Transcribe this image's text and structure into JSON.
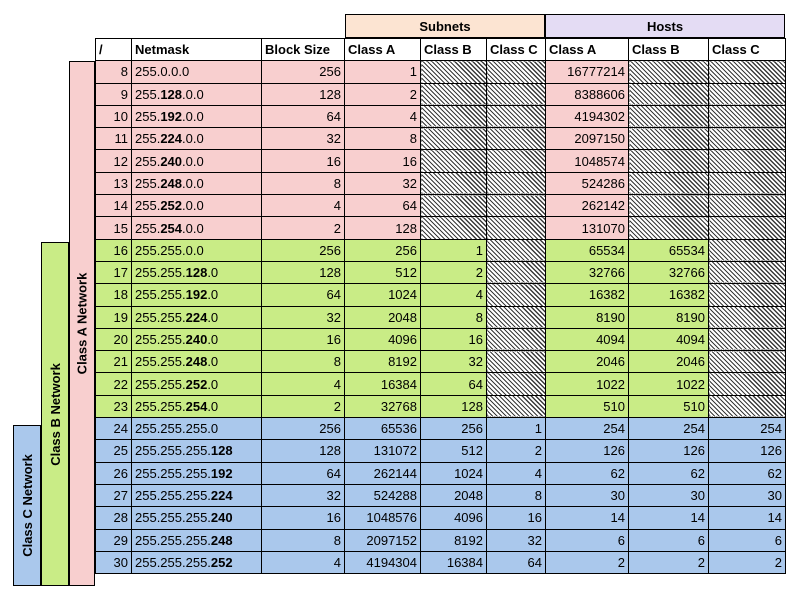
{
  "groups": {
    "subnets": "Subnets",
    "hosts": "Hosts"
  },
  "networks": {
    "a": "Class A Network",
    "b": "Class B Network",
    "c": "Class C Network"
  },
  "columns": [
    "/",
    "Netmask",
    "Block Size",
    "Class A",
    "Class B",
    "Class C",
    "Class A",
    "Class B",
    "Class C"
  ],
  "rows": [
    {
      "cls": "a",
      "prefix": "8",
      "nm_pre": "255.",
      "nm_bold": "",
      "nm_post": "0.0.0",
      "block": "256",
      "sa": "1",
      "sb": null,
      "sc": null,
      "ha": "16777214",
      "hb": null,
      "hc": null
    },
    {
      "cls": "a",
      "prefix": "9",
      "nm_pre": "255.",
      "nm_bold": "128",
      "nm_post": ".0.0",
      "block": "128",
      "sa": "2",
      "sb": null,
      "sc": null,
      "ha": "8388606",
      "hb": null,
      "hc": null
    },
    {
      "cls": "a",
      "prefix": "10",
      "nm_pre": "255.",
      "nm_bold": "192",
      "nm_post": ".0.0",
      "block": "64",
      "sa": "4",
      "sb": null,
      "sc": null,
      "ha": "4194302",
      "hb": null,
      "hc": null
    },
    {
      "cls": "a",
      "prefix": "11",
      "nm_pre": "255.",
      "nm_bold": "224",
      "nm_post": ".0.0",
      "block": "32",
      "sa": "8",
      "sb": null,
      "sc": null,
      "ha": "2097150",
      "hb": null,
      "hc": null
    },
    {
      "cls": "a",
      "prefix": "12",
      "nm_pre": "255.",
      "nm_bold": "240",
      "nm_post": ".0.0",
      "block": "16",
      "sa": "16",
      "sb": null,
      "sc": null,
      "ha": "1048574",
      "hb": null,
      "hc": null
    },
    {
      "cls": "a",
      "prefix": "13",
      "nm_pre": "255.",
      "nm_bold": "248",
      "nm_post": ".0.0",
      "block": "8",
      "sa": "32",
      "sb": null,
      "sc": null,
      "ha": "524286",
      "hb": null,
      "hc": null
    },
    {
      "cls": "a",
      "prefix": "14",
      "nm_pre": "255.",
      "nm_bold": "252",
      "nm_post": ".0.0",
      "block": "4",
      "sa": "64",
      "sb": null,
      "sc": null,
      "ha": "262142",
      "hb": null,
      "hc": null
    },
    {
      "cls": "a",
      "prefix": "15",
      "nm_pre": "255.",
      "nm_bold": "254",
      "nm_post": ".0.0",
      "block": "2",
      "sa": "128",
      "sb": null,
      "sc": null,
      "ha": "131070",
      "hb": null,
      "hc": null
    },
    {
      "cls": "b",
      "prefix": "16",
      "nm_pre": "255.255.",
      "nm_bold": "",
      "nm_post": "0.0",
      "block": "256",
      "sa": "256",
      "sb": "1",
      "sc": null,
      "ha": "65534",
      "hb": "65534",
      "hc": null
    },
    {
      "cls": "b",
      "prefix": "17",
      "nm_pre": "255.255.",
      "nm_bold": "128",
      "nm_post": ".0",
      "block": "128",
      "sa": "512",
      "sb": "2",
      "sc": null,
      "ha": "32766",
      "hb": "32766",
      "hc": null
    },
    {
      "cls": "b",
      "prefix": "18",
      "nm_pre": "255.255.",
      "nm_bold": "192",
      "nm_post": ".0",
      "block": "64",
      "sa": "1024",
      "sb": "4",
      "sc": null,
      "ha": "16382",
      "hb": "16382",
      "hc": null
    },
    {
      "cls": "b",
      "prefix": "19",
      "nm_pre": "255.255.",
      "nm_bold": "224",
      "nm_post": ".0",
      "block": "32",
      "sa": "2048",
      "sb": "8",
      "sc": null,
      "ha": "8190",
      "hb": "8190",
      "hc": null
    },
    {
      "cls": "b",
      "prefix": "20",
      "nm_pre": "255.255.",
      "nm_bold": "240",
      "nm_post": ".0",
      "block": "16",
      "sa": "4096",
      "sb": "16",
      "sc": null,
      "ha": "4094",
      "hb": "4094",
      "hc": null
    },
    {
      "cls": "b",
      "prefix": "21",
      "nm_pre": "255.255.",
      "nm_bold": "248",
      "nm_post": ".0",
      "block": "8",
      "sa": "8192",
      "sb": "32",
      "sc": null,
      "ha": "2046",
      "hb": "2046",
      "hc": null
    },
    {
      "cls": "b",
      "prefix": "22",
      "nm_pre": "255.255.",
      "nm_bold": "252",
      "nm_post": ".0",
      "block": "4",
      "sa": "16384",
      "sb": "64",
      "sc": null,
      "ha": "1022",
      "hb": "1022",
      "hc": null
    },
    {
      "cls": "b",
      "prefix": "23",
      "nm_pre": "255.255.",
      "nm_bold": "254",
      "nm_post": ".0",
      "block": "2",
      "sa": "32768",
      "sb": "128",
      "sc": null,
      "ha": "510",
      "hb": "510",
      "hc": null
    },
    {
      "cls": "c",
      "prefix": "24",
      "nm_pre": "255.255.255.",
      "nm_bold": "",
      "nm_post": "0",
      "block": "256",
      "sa": "65536",
      "sb": "256",
      "sc": "1",
      "ha": "254",
      "hb": "254",
      "hc": "254"
    },
    {
      "cls": "c",
      "prefix": "25",
      "nm_pre": "255.255.255.",
      "nm_bold": "128",
      "nm_post": "",
      "block": "128",
      "sa": "131072",
      "sb": "512",
      "sc": "2",
      "ha": "126",
      "hb": "126",
      "hc": "126"
    },
    {
      "cls": "c",
      "prefix": "26",
      "nm_pre": "255.255.255.",
      "nm_bold": "192",
      "nm_post": "",
      "block": "64",
      "sa": "262144",
      "sb": "1024",
      "sc": "4",
      "ha": "62",
      "hb": "62",
      "hc": "62"
    },
    {
      "cls": "c",
      "prefix": "27",
      "nm_pre": "255.255.255.",
      "nm_bold": "224",
      "nm_post": "",
      "block": "32",
      "sa": "524288",
      "sb": "2048",
      "sc": "8",
      "ha": "30",
      "hb": "30",
      "hc": "30"
    },
    {
      "cls": "c",
      "prefix": "28",
      "nm_pre": "255.255.255.",
      "nm_bold": "240",
      "nm_post": "",
      "block": "16",
      "sa": "1048576",
      "sb": "4096",
      "sc": "16",
      "ha": "14",
      "hb": "14",
      "hc": "14"
    },
    {
      "cls": "c",
      "prefix": "29",
      "nm_pre": "255.255.255.",
      "nm_bold": "248",
      "nm_post": "",
      "block": "8",
      "sa": "2097152",
      "sb": "8192",
      "sc": "32",
      "ha": "6",
      "hb": "6",
      "hc": "6"
    },
    {
      "cls": "c",
      "prefix": "30",
      "nm_pre": "255.255.255.",
      "nm_bold": "252",
      "nm_post": "",
      "block": "4",
      "sa": "4194304",
      "sb": "16384",
      "sc": "64",
      "ha": "2",
      "hb": "2",
      "hc": "2"
    }
  ],
  "colors": {
    "class_a": "#f8cfcf",
    "class_b": "#c9ec86",
    "class_c": "#aac8ec",
    "subnets_header": "#fce4d2",
    "hosts_header": "#e4dcf4"
  }
}
